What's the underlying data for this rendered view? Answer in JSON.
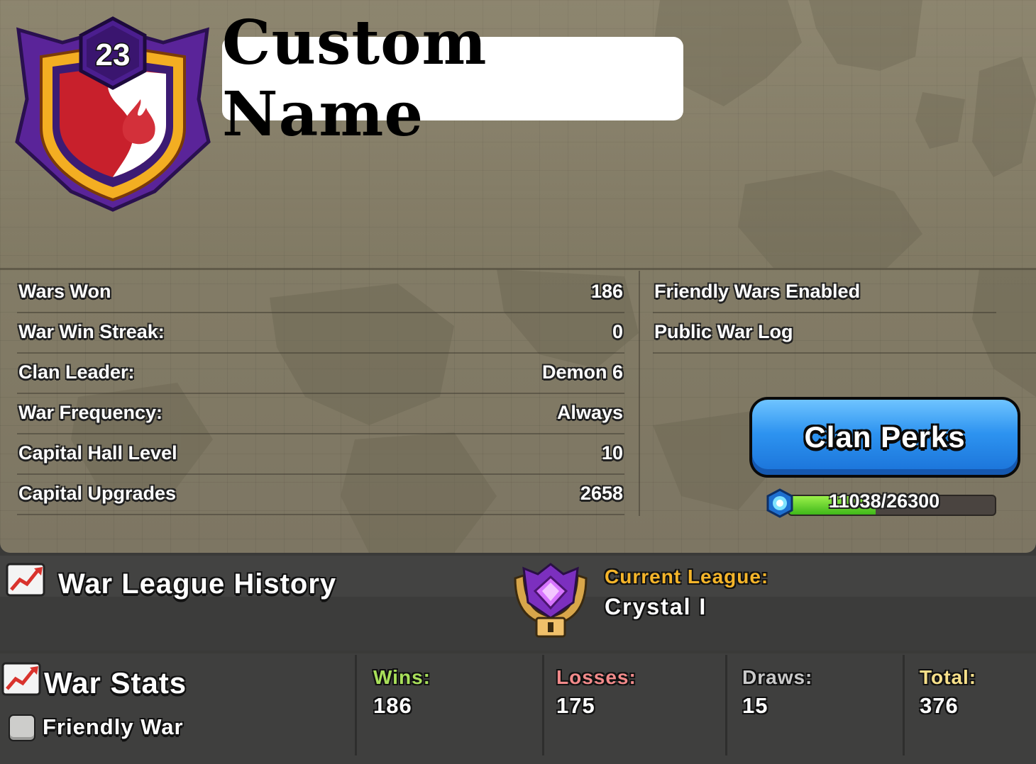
{
  "clan": {
    "level": "23",
    "name": "Custom Name"
  },
  "stats": [
    {
      "label": "Wars Won",
      "value": "186"
    },
    {
      "label": "War Win Streak:",
      "value": "0"
    },
    {
      "label": "Clan Leader:",
      "value": "Demon 6"
    },
    {
      "label": "War Frequency:",
      "value": "Always"
    },
    {
      "label": "Capital Hall Level",
      "value": "10"
    },
    {
      "label": "Capital Upgrades",
      "value": "2658"
    }
  ],
  "side": {
    "friendly_wars": "Friendly Wars Enabled",
    "war_log": "Public War Log"
  },
  "perks": {
    "button_label": "Clan Perks",
    "xp_text": "11038/26300",
    "xp_current": 11038,
    "xp_max": 26300
  },
  "league": {
    "history_title": "War League History",
    "current_label": "Current League:",
    "current_value": "Crystal I"
  },
  "war_stats": {
    "title": "War Stats",
    "friendly_war_label": "Friendly War",
    "columns": [
      {
        "label": "Wins:",
        "value": "186",
        "color": "#a9e05a"
      },
      {
        "label": "Losses:",
        "value": "175",
        "color": "#f28a8a"
      },
      {
        "label": "Draws:",
        "value": "15",
        "color": "#c9c9c9"
      },
      {
        "label": "Total:",
        "value": "376",
        "color": "#f7e08a"
      }
    ]
  },
  "colors": {
    "badge_purple": "#6b2fb3",
    "badge_gold": "#f0a820",
    "badge_red": "#c8202c",
    "button_blue": "#2d93f0",
    "league_gold": "#f5b52a",
    "xp_green": "#3fb81a"
  }
}
